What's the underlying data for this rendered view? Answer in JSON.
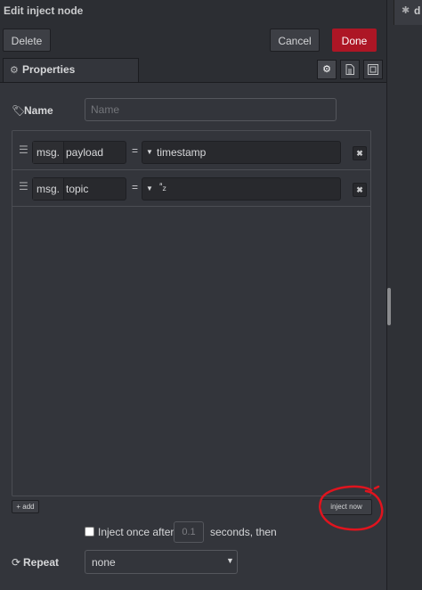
{
  "header": {
    "title": "Edit inject node",
    "right_tab_label": "d",
    "right_tab_icon": "bug-icon"
  },
  "buttons": {
    "delete": "Delete",
    "cancel": "Cancel",
    "done": "Done"
  },
  "tabs": {
    "properties_label": "Properties",
    "icons": [
      "gear-icon",
      "file-icon",
      "layout-icon"
    ]
  },
  "name": {
    "label": "Name",
    "placeholder": "Name",
    "value": ""
  },
  "properties": [
    {
      "prefix": "msg.",
      "field": "payload",
      "operator": "=",
      "type": "timestamp",
      "value": "timestamp"
    },
    {
      "prefix": "msg.",
      "field": "topic",
      "operator": "=",
      "type": "string",
      "type_icon": "az",
      "value": ""
    }
  ],
  "add_label": "add",
  "inject_now_label": "inject now",
  "inject_once": {
    "checked": false,
    "label": "Inject once after",
    "seconds_placeholder": "0.1",
    "suffix": "seconds, then"
  },
  "repeat": {
    "label": "Repeat",
    "value": "none"
  },
  "colors": {
    "done_button": "#ad1625",
    "annotation_circle": "#e0141e"
  }
}
